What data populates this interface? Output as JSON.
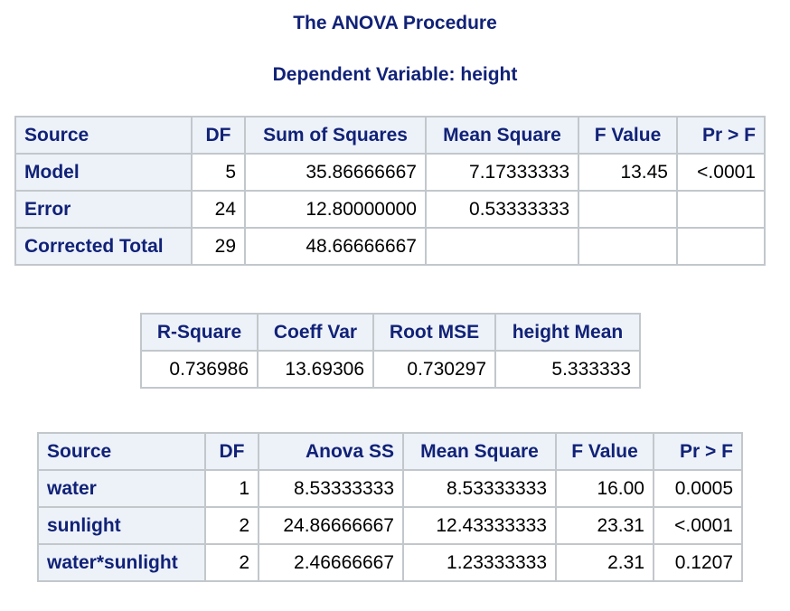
{
  "title": "The ANOVA Procedure",
  "subtitle": "Dependent Variable: height",
  "anova_table": {
    "headers": [
      "Source",
      "DF",
      "Sum of Squares",
      "Mean Square",
      "F Value",
      "Pr > F"
    ],
    "rows": [
      [
        "Model",
        "5",
        "35.86666667",
        "7.17333333",
        "13.45",
        "<.0001"
      ],
      [
        "Error",
        "24",
        "12.80000000",
        "0.53333333",
        "",
        ""
      ],
      [
        "Corrected Total",
        "29",
        "48.66666667",
        "",
        "",
        ""
      ]
    ]
  },
  "fit_table": {
    "headers": [
      "R-Square",
      "Coeff Var",
      "Root MSE",
      "height Mean"
    ],
    "row": [
      "0.736986",
      "13.69306",
      "0.730297",
      "5.333333"
    ]
  },
  "effects_table": {
    "headers": [
      "Source",
      "DF",
      "Anova SS",
      "Mean Square",
      "F Value",
      "Pr > F"
    ],
    "rows": [
      [
        "water",
        "1",
        "8.53333333",
        "8.53333333",
        "16.00",
        "0.0005"
      ],
      [
        "sunlight",
        "2",
        "24.86666667",
        "12.43333333",
        "23.31",
        "<.0001"
      ],
      [
        "water*sunlight",
        "2",
        "2.46666667",
        "1.23333333",
        "2.31",
        "0.1207"
      ]
    ]
  }
}
